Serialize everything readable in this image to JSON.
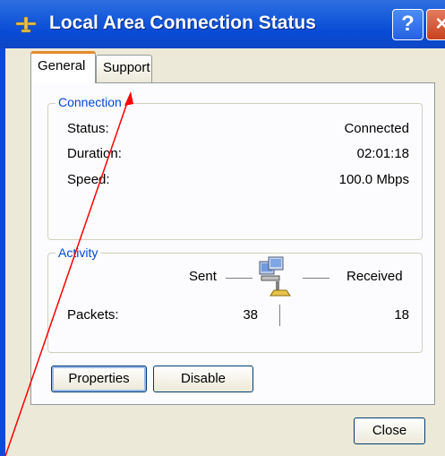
{
  "window": {
    "title": "Local Area Connection Status",
    "help_label": "?",
    "close_label": "×"
  },
  "tabs": [
    {
      "label": "General"
    },
    {
      "label": "Support"
    }
  ],
  "connection": {
    "group_label": "Connection",
    "rows": [
      {
        "label": "Status:",
        "value": "Connected"
      },
      {
        "label": "Duration:",
        "value": "02:01:18"
      },
      {
        "label": "Speed:",
        "value": "100.0 Mbps"
      }
    ]
  },
  "activity": {
    "group_label": "Activity",
    "sent_label": "Sent",
    "received_label": "Received",
    "packets_label": "Packets:",
    "packets_sent": "38",
    "packets_received": "18"
  },
  "buttons": {
    "properties": "Properties",
    "disable": "Disable",
    "close": "Close"
  },
  "colors": {
    "title_bar": "#0a4bd6",
    "group_label": "#0046d5",
    "annotation_arrow": "#ff0000"
  }
}
